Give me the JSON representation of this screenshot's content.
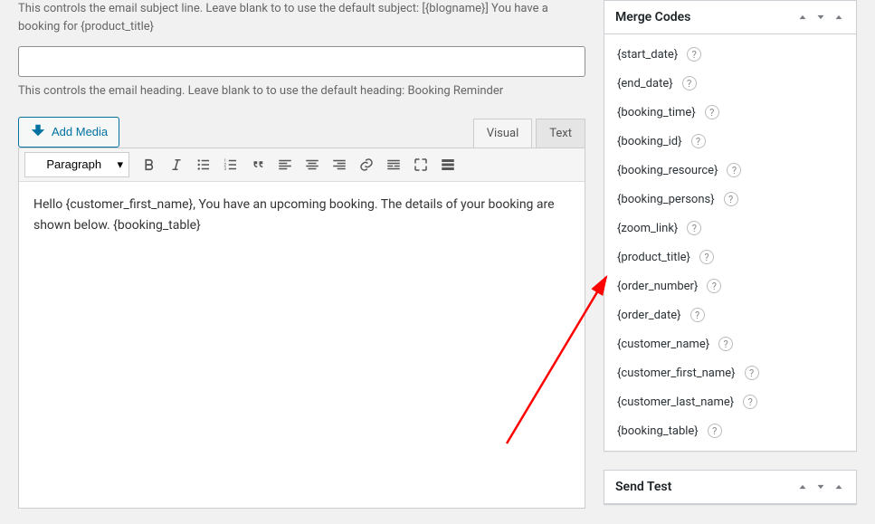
{
  "left": {
    "subject_help": "This controls the email subject line. Leave blank to to use the default subject: [{blogname}] You have a booking for {product_title}",
    "heading_value": "",
    "heading_help": "This controls the email heading. Leave blank to to use the default heading: Booking Reminder",
    "add_media_label": "Add Media",
    "tabs": {
      "visual": "Visual",
      "text": "Text"
    },
    "format_label": "Paragraph",
    "body_text": "Hello {customer_first_name}, You have an upcoming booking. The details of your booking are shown below. {booking_table}"
  },
  "merge_panel": {
    "title": "Merge Codes",
    "codes": [
      "{start_date}",
      "{end_date}",
      "{booking_time}",
      "{booking_id}",
      "{booking_resource}",
      "{booking_persons}",
      "{zoom_link}",
      "{product_title}",
      "{order_number}",
      "{order_date}",
      "{customer_name}",
      "{customer_first_name}",
      "{customer_last_name}",
      "{booking_table}"
    ]
  },
  "send_test_panel": {
    "title": "Send Test"
  }
}
